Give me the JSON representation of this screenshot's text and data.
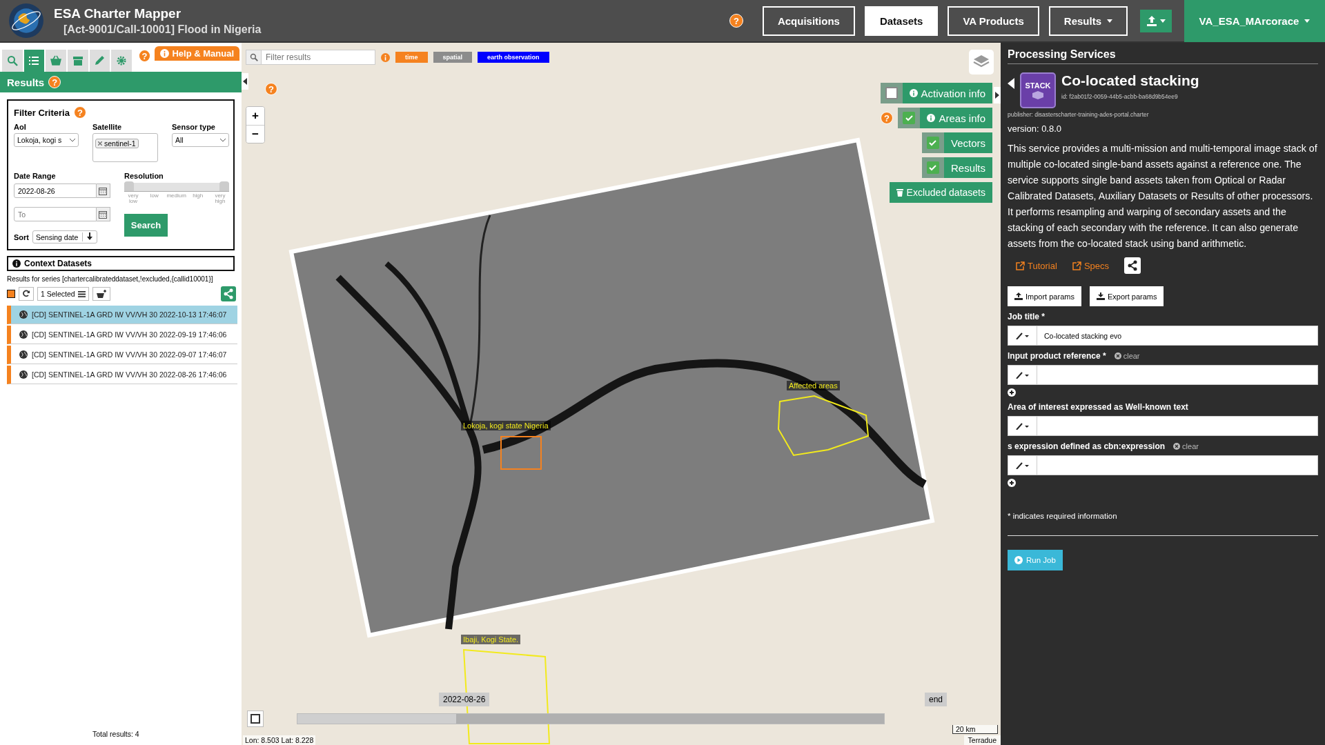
{
  "header": {
    "title": "ESA Charter Mapper",
    "subtitle": "[Act-9001/Call-10001] Flood in Nigeria",
    "help": "?",
    "nav": [
      {
        "label": "Acquisitions",
        "selected": false,
        "dropdown": false
      },
      {
        "label": "Datasets",
        "selected": true,
        "dropdown": false
      },
      {
        "label": "VA Products",
        "selected": false,
        "dropdown": false
      },
      {
        "label": "Results",
        "selected": false,
        "dropdown": true
      }
    ],
    "user": "VA_ESA_MArcorace"
  },
  "sidebar": {
    "tools": [
      {
        "kind": "search",
        "selected": false
      },
      {
        "kind": "list",
        "selected": true
      },
      {
        "kind": "basket",
        "selected": false
      },
      {
        "kind": "archive",
        "selected": false
      },
      {
        "kind": "pencil",
        "selected": false
      },
      {
        "kind": "gear",
        "selected": false
      }
    ],
    "help": "?",
    "manual": "Help & Manual",
    "title": "Results",
    "title_help": "?",
    "filter": {
      "title": "Filter Criteria",
      "help": "?",
      "aoi_label": "AoI",
      "aoi_value": "Lokoja, kogi s",
      "satellite_label": "Satellite",
      "satellite_tag": "sentinel-1",
      "sensor_label": "Sensor type",
      "sensor_value": "All",
      "date_label": "Date Range",
      "date_from": "2022-08-26",
      "date_to_placeholder": "To",
      "resolution_label": "Resolution",
      "resolution_slider": {
        "level": 1
      },
      "resolution_ticks": [
        "very low",
        "low",
        "medium",
        "high",
        "very high"
      ],
      "search": "Search",
      "sort_label": "Sort",
      "sort_value": "Sensing date"
    },
    "context_title": "Context Datasets",
    "series": "Results for series [chartercalibrateddataset,!excluded,{callid10001}]",
    "select_all_checked": true,
    "selected_count": "1 Selected",
    "results": [
      {
        "label": "[CD] SENTINEL-1A GRD IW VV/VH 30 2022-10-13 17:46:07",
        "selected": true
      },
      {
        "label": "[CD] SENTINEL-1A GRD IW VV/VH 30 2022-09-19 17:46:06",
        "selected": false
      },
      {
        "label": "[CD] SENTINEL-1A GRD IW VV/VH 30 2022-09-07 17:46:07",
        "selected": false
      },
      {
        "label": "[CD] SENTINEL-1A GRD IW VV/VH 30 2022-08-26 17:46:06",
        "selected": false
      }
    ],
    "total": "Total results: 4"
  },
  "map": {
    "filter_placeholder": "Filter results",
    "tags": [
      {
        "label": "time",
        "color": "#f5821f"
      },
      {
        "label": "spatial",
        "color": "#8c8c8c"
      },
      {
        "label": "earth observation",
        "color": "#0000ff"
      }
    ],
    "help_marks": [
      "?",
      "?"
    ],
    "toggles": [
      {
        "label": "Activation info",
        "checked": false
      },
      {
        "label": "Areas info",
        "checked": true
      },
      {
        "label": "Vectors",
        "checked": true
      },
      {
        "label": "Results",
        "checked": true
      }
    ],
    "excluded": "Excluded datasets",
    "zoom_in": "+",
    "zoom_out": "−",
    "areas": [
      {
        "label": "Lokoja, kogi state Nigeria",
        "kind": "aoi"
      },
      {
        "label": "Affected areas",
        "kind": "affected"
      },
      {
        "label": "Ibaji, Kogi State.",
        "kind": "affected"
      }
    ],
    "timeline": {
      "start": "2022-08-26",
      "end": "end",
      "level": 0.73
    },
    "scale": "20 km",
    "coords": "Lon: 8.503 Lat: 8.228",
    "attribution": "Terradue"
  },
  "service": {
    "panel_title": "Processing Services",
    "name": "Co-located stacking",
    "icon_label": "STACK",
    "id": "id: f2ab01f2-0059-44b5-acbb-ba68d9b54ee9",
    "publisher": "publisher: disasterscharter-training-ades-portal.charter",
    "version": "version: 0.8.0",
    "description": "This service provides a multi-mission and multi-temporal image stack of multiple co-located single-band assets against a reference one. The service supports single band assets taken from Optical or Radar Calibrated Datasets, Auxiliary Datasets or Results of other processors. It performs resampling and warping of secondary assets and the stacking of each secondary with the reference. It can also generate assets from the co-located stack using band arithmetic.",
    "links": [
      "Tutorial",
      "Specs"
    ],
    "import": "Import params",
    "export": "Export params",
    "fields": [
      {
        "label": "Job title *",
        "value": "Co-located stacking evo",
        "add": false
      },
      {
        "label": "Input product reference *",
        "clear": "clear",
        "add": true
      },
      {
        "label": "Area of interest expressed as Well-known text",
        "add": false
      },
      {
        "label": "s expression defined as cbn:expression",
        "clear": "clear",
        "add": true
      }
    ],
    "note": "* indicates required information",
    "run": "Run Job"
  }
}
